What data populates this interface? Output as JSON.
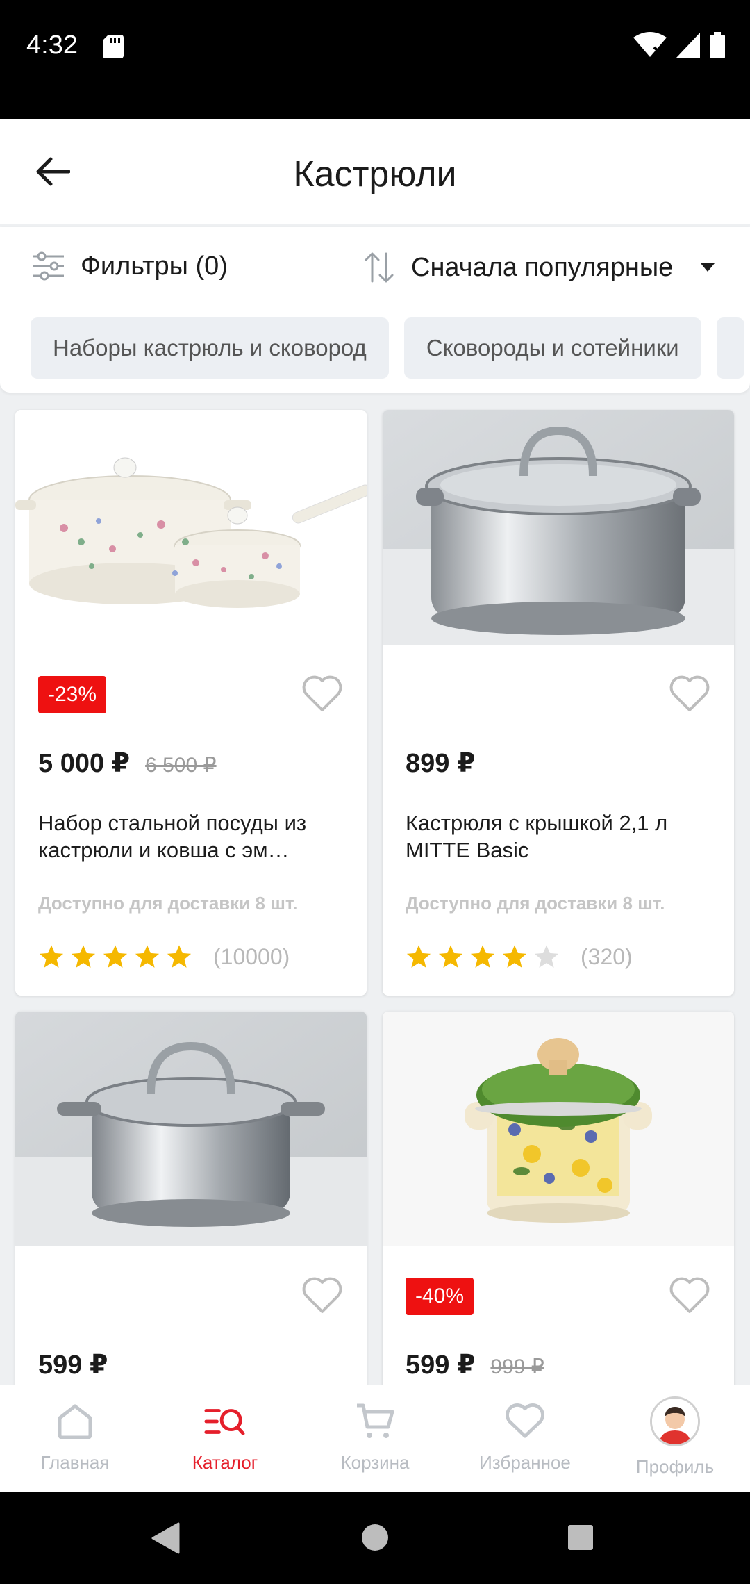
{
  "status_bar": {
    "time": "4:32"
  },
  "app_bar": {
    "title": "Кастрюли"
  },
  "toolbar": {
    "filters_label": "Фильтры (0)",
    "sort_label": "Сначала популярные"
  },
  "chips": [
    "Наборы кастрюль и сковород",
    "Сковороды и сотейники"
  ],
  "products": [
    {
      "discount": "-23%",
      "price": "5 000 ₽",
      "old_price": "6 500 ₽",
      "name": "Набор стальной посуды из кастрюли и ковша с эм…",
      "availability": "Доступно для доставки 8 шт.",
      "rating": 5,
      "reviews": "(10000)"
    },
    {
      "discount": "",
      "price": "899 ₽",
      "old_price": "",
      "name": "Кастрюля с крышкой 2,1 л MITTE Basic",
      "availability": "Доступно для доставки 8 шт.",
      "rating": 4,
      "reviews": "(320)"
    },
    {
      "discount": "",
      "price": "599 ₽",
      "old_price": ""
    },
    {
      "discount": "-40%",
      "price": "599 ₽",
      "old_price": "999 ₽"
    }
  ],
  "bottom_nav": [
    {
      "label": "Главная",
      "icon": "home-icon",
      "active": false
    },
    {
      "label": "Каталог",
      "icon": "catalog-search-icon",
      "active": true
    },
    {
      "label": "Корзина",
      "icon": "cart-icon",
      "active": false
    },
    {
      "label": "Избранное",
      "icon": "heart-icon",
      "active": false
    },
    {
      "label": "Профиль",
      "icon": "avatar",
      "active": false
    }
  ],
  "colors": {
    "accent": "#e51f2b",
    "discount": "#ee1111",
    "star": "#f5b800",
    "star_empty": "#dddddd"
  }
}
